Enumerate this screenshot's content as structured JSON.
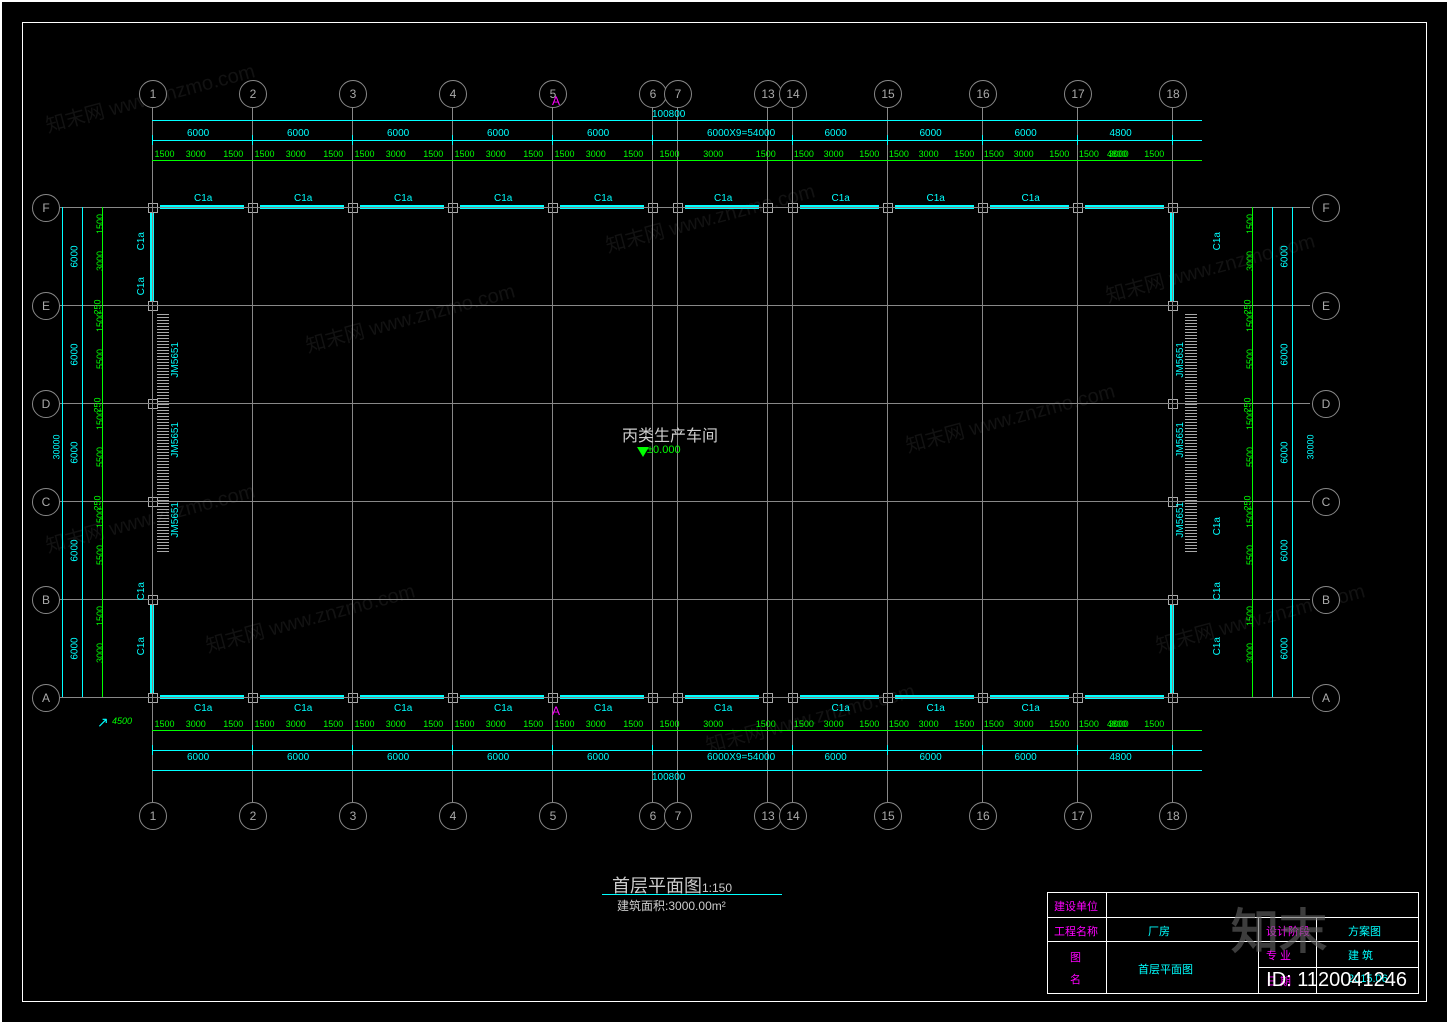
{
  "grid": {
    "horizontal_axes": [
      "A",
      "B",
      "C",
      "D",
      "E",
      "F"
    ],
    "vertical_axes": [
      "1",
      "2",
      "3",
      "4",
      "5",
      "6",
      "7",
      "13",
      "14",
      "15",
      "16",
      "17",
      "18"
    ]
  },
  "dims": {
    "overall_length": "100800",
    "overall_width": "30000",
    "bay_primary": "6000",
    "bay_secondary": "1500",
    "bay_secondary2": "3000",
    "bay_end": "4800",
    "multi_bay": "6000X9=54000",
    "side_250": "250",
    "side_5500": "5500",
    "side_4500": "4500"
  },
  "room": {
    "name": "丙类生产车间",
    "elev": "±0.000"
  },
  "title": {
    "name": "首层平面图",
    "scale": "1:150",
    "area_label": "建筑面积",
    "area_value": "3000.00m²"
  },
  "windows": {
    "label": "C1a"
  },
  "doors": {
    "label": "JM5651"
  },
  "section": {
    "label": "A"
  },
  "north": {
    "label": "4500"
  },
  "titleblock": {
    "row1": {
      "label": "建设单位",
      "value": ""
    },
    "row2": {
      "label": "工程名称",
      "value": "厂房",
      "label2": "设计阶段",
      "value2": "方案图"
    },
    "row3": {
      "label": "图",
      "label_b": "名",
      "value": "首层平面图",
      "label2": "专  业",
      "value2": "建  筑",
      "label3": "日  期",
      "value3": "2015.06"
    }
  },
  "watermark": {
    "text": "知末网 www.znzmo.com",
    "logo": "知末",
    "id": "ID: 1120041246"
  }
}
